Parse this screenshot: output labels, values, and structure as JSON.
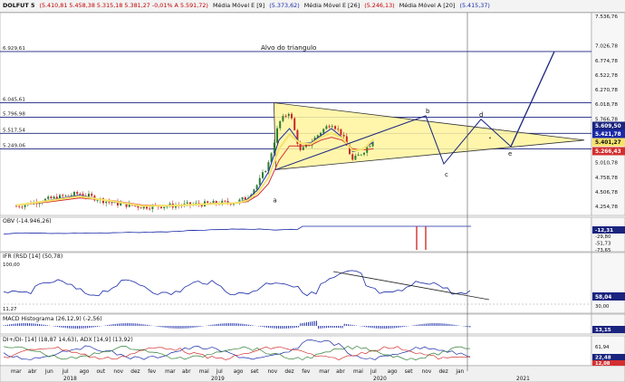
{
  "header": {
    "symbol": "DOLFUT 5",
    "ohlc": "(5.410,81  5.458,38  5.315,18  5.381,27  -0,01%  A 5.591,72)",
    "ma1_label": "Média Móvel E [9]",
    "ma1_value": "(5.373,62)",
    "ma2_label": "Média Móvel E [26]",
    "ma2_value": "(5.246,13)",
    "ma3_label": "Média Móvel A [20]",
    "ma3_value": "(5.415,37)"
  },
  "colors": {
    "header_red": "#c00000",
    "header_blue": "#1a2aa8",
    "price_line": "#1a237e",
    "ma_blue": "#1a2aa8",
    "ma_red": "#d32f2f",
    "ma_yellow": "#f6e36a",
    "triangle_fill": "#fff59d",
    "candle_up": "#2e7d32",
    "candle_down": "#c62828"
  },
  "annotations": {
    "target_text": "Alvo do triangulo",
    "points": [
      "a",
      "b",
      "c",
      "d",
      "e"
    ]
  },
  "price_panel": {
    "left_levels": [
      {
        "label": "6.929,61",
        "value": 6929.61
      },
      {
        "label": "6.045,61",
        "value": 6045.61
      },
      {
        "label": "5.796,98",
        "value": 5796.98
      },
      {
        "label": "5.517,54",
        "value": 5517.54
      },
      {
        "label": "5.249,06",
        "value": 5249.06
      }
    ],
    "right_ticks": [
      {
        "label": "7.536,76",
        "value": 7536.76
      },
      {
        "label": "7.026,78",
        "value": 7026.78
      },
      {
        "label": "6.774,78",
        "value": 6774.78
      },
      {
        "label": "6.522,78",
        "value": 6522.78
      },
      {
        "label": "6.270,78",
        "value": 6270.78
      },
      {
        "label": "6.018,78",
        "value": 6018.78
      },
      {
        "label": "5.766,78",
        "value": 5766.78
      },
      {
        "label": "5.514,78",
        "value": 5514.78
      },
      {
        "label": "5.010,78",
        "value": 5010.78
      },
      {
        "label": "4.758,78",
        "value": 4758.78
      },
      {
        "label": "4.506,78",
        "value": 4506.78
      },
      {
        "label": "4.254,78",
        "value": 4254.78
      }
    ],
    "badges": [
      {
        "label": "5.609,50",
        "value": 5609.5,
        "color": "#1a237e"
      },
      {
        "label": "5.421,78",
        "value": 5421.78,
        "color": "#1a2aa8"
      },
      {
        "label": "5.401,27",
        "value": 5401.27,
        "color": "#f6e36a"
      },
      {
        "label": "5.266,43",
        "value": 5266.43,
        "color": "#d32f2f"
      }
    ]
  },
  "obv_panel": {
    "title": "OBV (-14.946,26)",
    "badge": "-12,31",
    "ticks": [
      "-29,80",
      "-51,73",
      "-73,65"
    ]
  },
  "ifr_panel": {
    "title": "IFR (RSD [14] (50,78)",
    "left_levels": [
      "100,00",
      "11,27"
    ],
    "badge": "58,04",
    "ticks": [
      "30,00"
    ]
  },
  "macd_panel": {
    "title": "MACD Histograma (26,12,9) (-2,56)",
    "badge": "13,15"
  },
  "adx_panel": {
    "title": "DI+/DI- [14] (18,87  14,63), ADX [14,9] (13,92)",
    "ticks": [
      "61,94"
    ],
    "badges": [
      "22,48",
      "12,08"
    ]
  },
  "time_axis": {
    "months": [
      "mar",
      "abr",
      "jun",
      "jul",
      "ago",
      "out",
      "nov",
      "dez",
      "fev",
      "mar",
      "abr",
      "mai",
      "jul",
      "ago",
      "set",
      "nov",
      "dez",
      "fev",
      "mar",
      "abr",
      "mai",
      "jul",
      "ago",
      "set",
      "nov",
      "dez",
      "jan"
    ],
    "years": [
      "2018",
      "2019",
      "2020",
      "2021"
    ]
  },
  "chart_data": {
    "type": "line",
    "title": "",
    "xlabel": "",
    "ylabel": "",
    "ylim": [
      4100,
      7600
    ],
    "x": [
      "2018-03",
      "2018-06",
      "2018-09",
      "2018-12",
      "2019-03",
      "2019-06",
      "2019-09",
      "2019-12",
      "2020-01",
      "2020-02",
      "2020-03",
      "2020-04",
      "2020-05",
      "2020-06",
      "2020-07",
      "2020-08",
      "2020-09",
      "2020-10",
      "2020-11",
      "2020-12",
      "2021-01"
    ],
    "series": [
      {
        "name": "DOLFUT 5",
        "values": [
          4260,
          4380,
          4480,
          4320,
          4250,
          4270,
          4300,
          4330,
          4420,
          4650,
          5000,
          5700,
          5900,
          5200,
          5350,
          5550,
          5700,
          5500,
          5050,
          5200,
          5400
        ]
      },
      {
        "name": "Média Móvel E [9]",
        "values": [
          4270,
          4360,
          4450,
          4340,
          4260,
          4270,
          4300,
          4320,
          4380,
          4550,
          4850,
          5400,
          5600,
          5350,
          5350,
          5480,
          5600,
          5450,
          5200,
          5250,
          5370
        ]
      },
      {
        "name": "Média Móvel E [26]",
        "values": [
          4280,
          4330,
          4400,
          4360,
          4280,
          4270,
          4290,
          4310,
          4340,
          4450,
          4650,
          5050,
          5300,
          5300,
          5310,
          5400,
          5450,
          5400,
          5250,
          5230,
          5250
        ]
      },
      {
        "name": "Média Móvel A [20]",
        "values": [
          4275,
          4350,
          4430,
          4350,
          4265,
          4270,
          4295,
          4315,
          4360,
          4500,
          4750,
          5250,
          5500,
          5350,
          5330,
          5450,
          5520,
          5440,
          5220,
          5240,
          5415
        ]
      }
    ],
    "triangle": {
      "apex_a": 4890,
      "apex_top": 6045,
      "apex_right": 5400
    },
    "target_level": 6929.61,
    "channel_levels": [
      6045.61,
      5796.98,
      5517.54,
      5249.06
    ],
    "grid": false,
    "legend": "none"
  }
}
